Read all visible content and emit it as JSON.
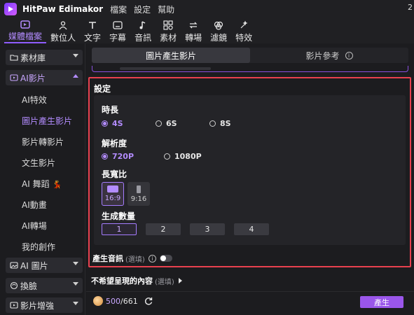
{
  "titlebar": {
    "app_name": "HitPaw Edimakor",
    "menu": [
      "檔案",
      "設定",
      "幫助"
    ],
    "right_text": "2"
  },
  "toolbar": [
    {
      "label": "媒體檔案",
      "icon": "media-icon",
      "active": true
    },
    {
      "label": "數位人",
      "icon": "avatar-person-icon"
    },
    {
      "label": "文字",
      "icon": "text-icon"
    },
    {
      "label": "字幕",
      "icon": "subtitle-icon"
    },
    {
      "label": "音訊",
      "icon": "music-note-icon"
    },
    {
      "label": "素材",
      "icon": "elements-icon"
    },
    {
      "label": "轉場",
      "icon": "transition-icon"
    },
    {
      "label": "濾鏡",
      "icon": "filter-icon"
    },
    {
      "label": "特效",
      "icon": "effects-icon"
    }
  ],
  "sidebar": {
    "groups": {
      "library": "素材庫",
      "ai_video": "AI影片",
      "ai_image": "AI 圖片",
      "face_swap": "換臉",
      "enhance": "影片增強"
    },
    "ai_video_items": [
      "AI特效",
      "圖片產生影片",
      "影片轉影片",
      "文生影片",
      "AI 舞蹈",
      "AI動畫",
      "AI轉場",
      "我的創作"
    ],
    "active_item": "圖片產生影片"
  },
  "tabs": {
    "active": "圖片產生影片",
    "other": "影片參考"
  },
  "settings": {
    "title": "設定",
    "duration": {
      "label": "時長",
      "options": [
        "4S",
        "6S",
        "8S"
      ],
      "selected": "4S"
    },
    "resolution": {
      "label": "解析度",
      "options": [
        "720P",
        "1080P"
      ],
      "selected": "720P"
    },
    "aspect": {
      "label": "長寬比",
      "options": [
        "16:9",
        "9:16"
      ],
      "selected": "16:9"
    },
    "count": {
      "label": "生成數量",
      "options": [
        "1",
        "2",
        "3",
        "4"
      ],
      "selected": "1"
    },
    "audio": {
      "label": "產生音訊",
      "optional": "(選填)",
      "enabled": false
    }
  },
  "negative": {
    "label": "不希望呈現的內容",
    "optional": "(選填)"
  },
  "footer": {
    "credits_used": "500",
    "credits_total": "/661",
    "generate_label": "產生"
  },
  "colors": {
    "accent": "#9a56ea",
    "highlight_border": "#e8414f",
    "active_text": "#b38cff"
  }
}
